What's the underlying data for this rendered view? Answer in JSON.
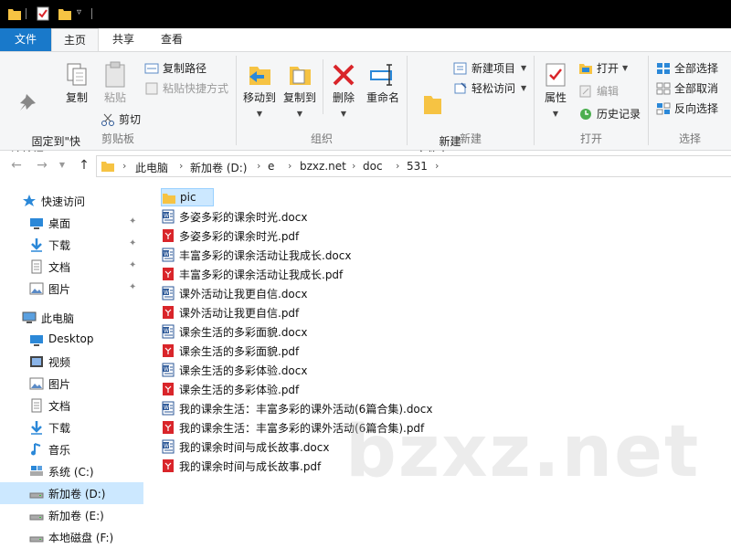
{
  "titlebar": {
    "icons": [
      "folder-icon",
      "checklist-icon",
      "folder-icon",
      "dropdown-arrow-icon"
    ]
  },
  "tabs": {
    "file": "文件",
    "home": "主页",
    "share": "共享",
    "view": "查看"
  },
  "ribbon": {
    "clipboard": {
      "label": "剪贴板",
      "pin_quick": "固定到\"快\n速访问\"",
      "copy": "复制",
      "paste": "粘贴",
      "copy_path": "复制路径",
      "paste_shortcut": "粘贴快捷方式",
      "cut": "剪切"
    },
    "organize": {
      "label": "组织",
      "move_to": "移动到",
      "copy_to": "复制到",
      "delete": "删除",
      "rename": "重命名"
    },
    "new": {
      "label": "新建",
      "new_folder": "新建\n文件夹",
      "new_item": "新建项目",
      "easy_access": "轻松访问"
    },
    "open": {
      "label": "打开",
      "properties": "属性",
      "open": "打开",
      "edit": "编辑",
      "history": "历史记录"
    },
    "select": {
      "label": "选择",
      "select_all": "全部选择",
      "select_none": "全部取消",
      "invert": "反向选择"
    }
  },
  "address": {
    "crumbs": [
      "此电脑",
      "新加卷 (D:)",
      "e",
      "bzxz.net",
      "doc",
      "531"
    ]
  },
  "navpane": {
    "quick_access": "快速访问",
    "quick_items": [
      "桌面",
      "下载",
      "文档",
      "图片"
    ],
    "this_pc": "此电脑",
    "pc_items": [
      "Desktop",
      "视频",
      "图片",
      "文档",
      "下载",
      "音乐",
      "系统 (C:)",
      "新加卷 (D:)",
      "新加卷 (E:)",
      "本地磁盘 (F:)"
    ]
  },
  "files": [
    {
      "name": "pic",
      "type": "folder"
    },
    {
      "name": "多姿多彩的课余时光.docx",
      "type": "docx"
    },
    {
      "name": "多姿多彩的课余时光.pdf",
      "type": "pdf"
    },
    {
      "name": "丰富多彩的课余活动让我成长.docx",
      "type": "docx"
    },
    {
      "name": "丰富多彩的课余活动让我成长.pdf",
      "type": "pdf"
    },
    {
      "name": "课外活动让我更自信.docx",
      "type": "docx"
    },
    {
      "name": "课外活动让我更自信.pdf",
      "type": "pdf"
    },
    {
      "name": "课余生活的多彩面貌.docx",
      "type": "docx"
    },
    {
      "name": "课余生活的多彩面貌.pdf",
      "type": "pdf"
    },
    {
      "name": "课余生活的多彩体验.docx",
      "type": "docx"
    },
    {
      "name": "课余生活的多彩体验.pdf",
      "type": "pdf"
    },
    {
      "name": "我的课余生活：丰富多彩的课外活动(6篇合集).docx",
      "type": "docx"
    },
    {
      "name": "我的课余生活：丰富多彩的课外活动(6篇合集).pdf",
      "type": "pdf"
    },
    {
      "name": "我的课余时间与成长故事.docx",
      "type": "docx"
    },
    {
      "name": "我的课余时间与成长故事.pdf",
      "type": "pdf"
    }
  ],
  "watermark": "bzxz.net",
  "colors": {
    "file_tab": "#1979ca",
    "selection": "#cce8ff",
    "folder": "#f6c343",
    "pdf": "#d9252a",
    "docx": "#2b5797"
  }
}
